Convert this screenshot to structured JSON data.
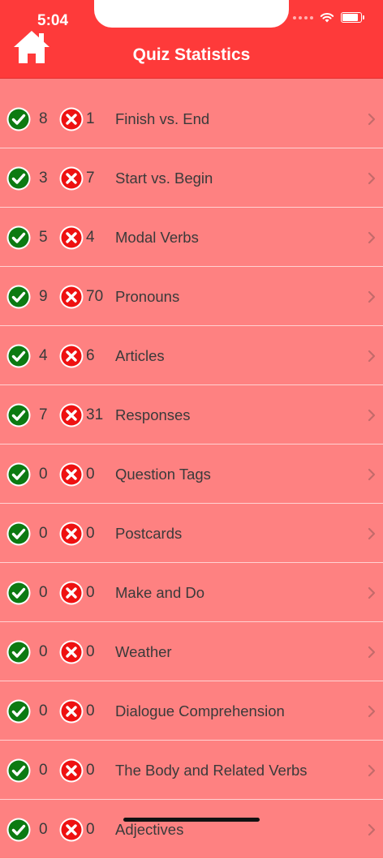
{
  "status_bar": {
    "time": "5:04"
  },
  "header": {
    "title": "Quiz Statistics",
    "home_icon": "home-icon"
  },
  "colors": {
    "header": "#fe3a3a",
    "background": "#fe8181",
    "correct": "#0c7a12",
    "wrong": "#ee1111"
  },
  "rows": [
    {
      "correct": "8",
      "wrong": "1",
      "label": "Finish vs. End"
    },
    {
      "correct": "3",
      "wrong": "7",
      "label": "Start vs. Begin"
    },
    {
      "correct": "5",
      "wrong": "4",
      "label": "Modal Verbs"
    },
    {
      "correct": "9",
      "wrong": "70",
      "label": "Pronouns"
    },
    {
      "correct": "4",
      "wrong": "6",
      "label": "Articles"
    },
    {
      "correct": "7",
      "wrong": "31",
      "label": "Responses"
    },
    {
      "correct": "0",
      "wrong": "0",
      "label": "Question Tags"
    },
    {
      "correct": "0",
      "wrong": "0",
      "label": "Postcards"
    },
    {
      "correct": "0",
      "wrong": "0",
      "label": "Make and Do"
    },
    {
      "correct": "0",
      "wrong": "0",
      "label": "Weather"
    },
    {
      "correct": "0",
      "wrong": "0",
      "label": "Dialogue Comprehension"
    },
    {
      "correct": "0",
      "wrong": "0",
      "label": "The Body and Related Verbs"
    },
    {
      "correct": "0",
      "wrong": "0",
      "label": "Adjectives"
    }
  ]
}
